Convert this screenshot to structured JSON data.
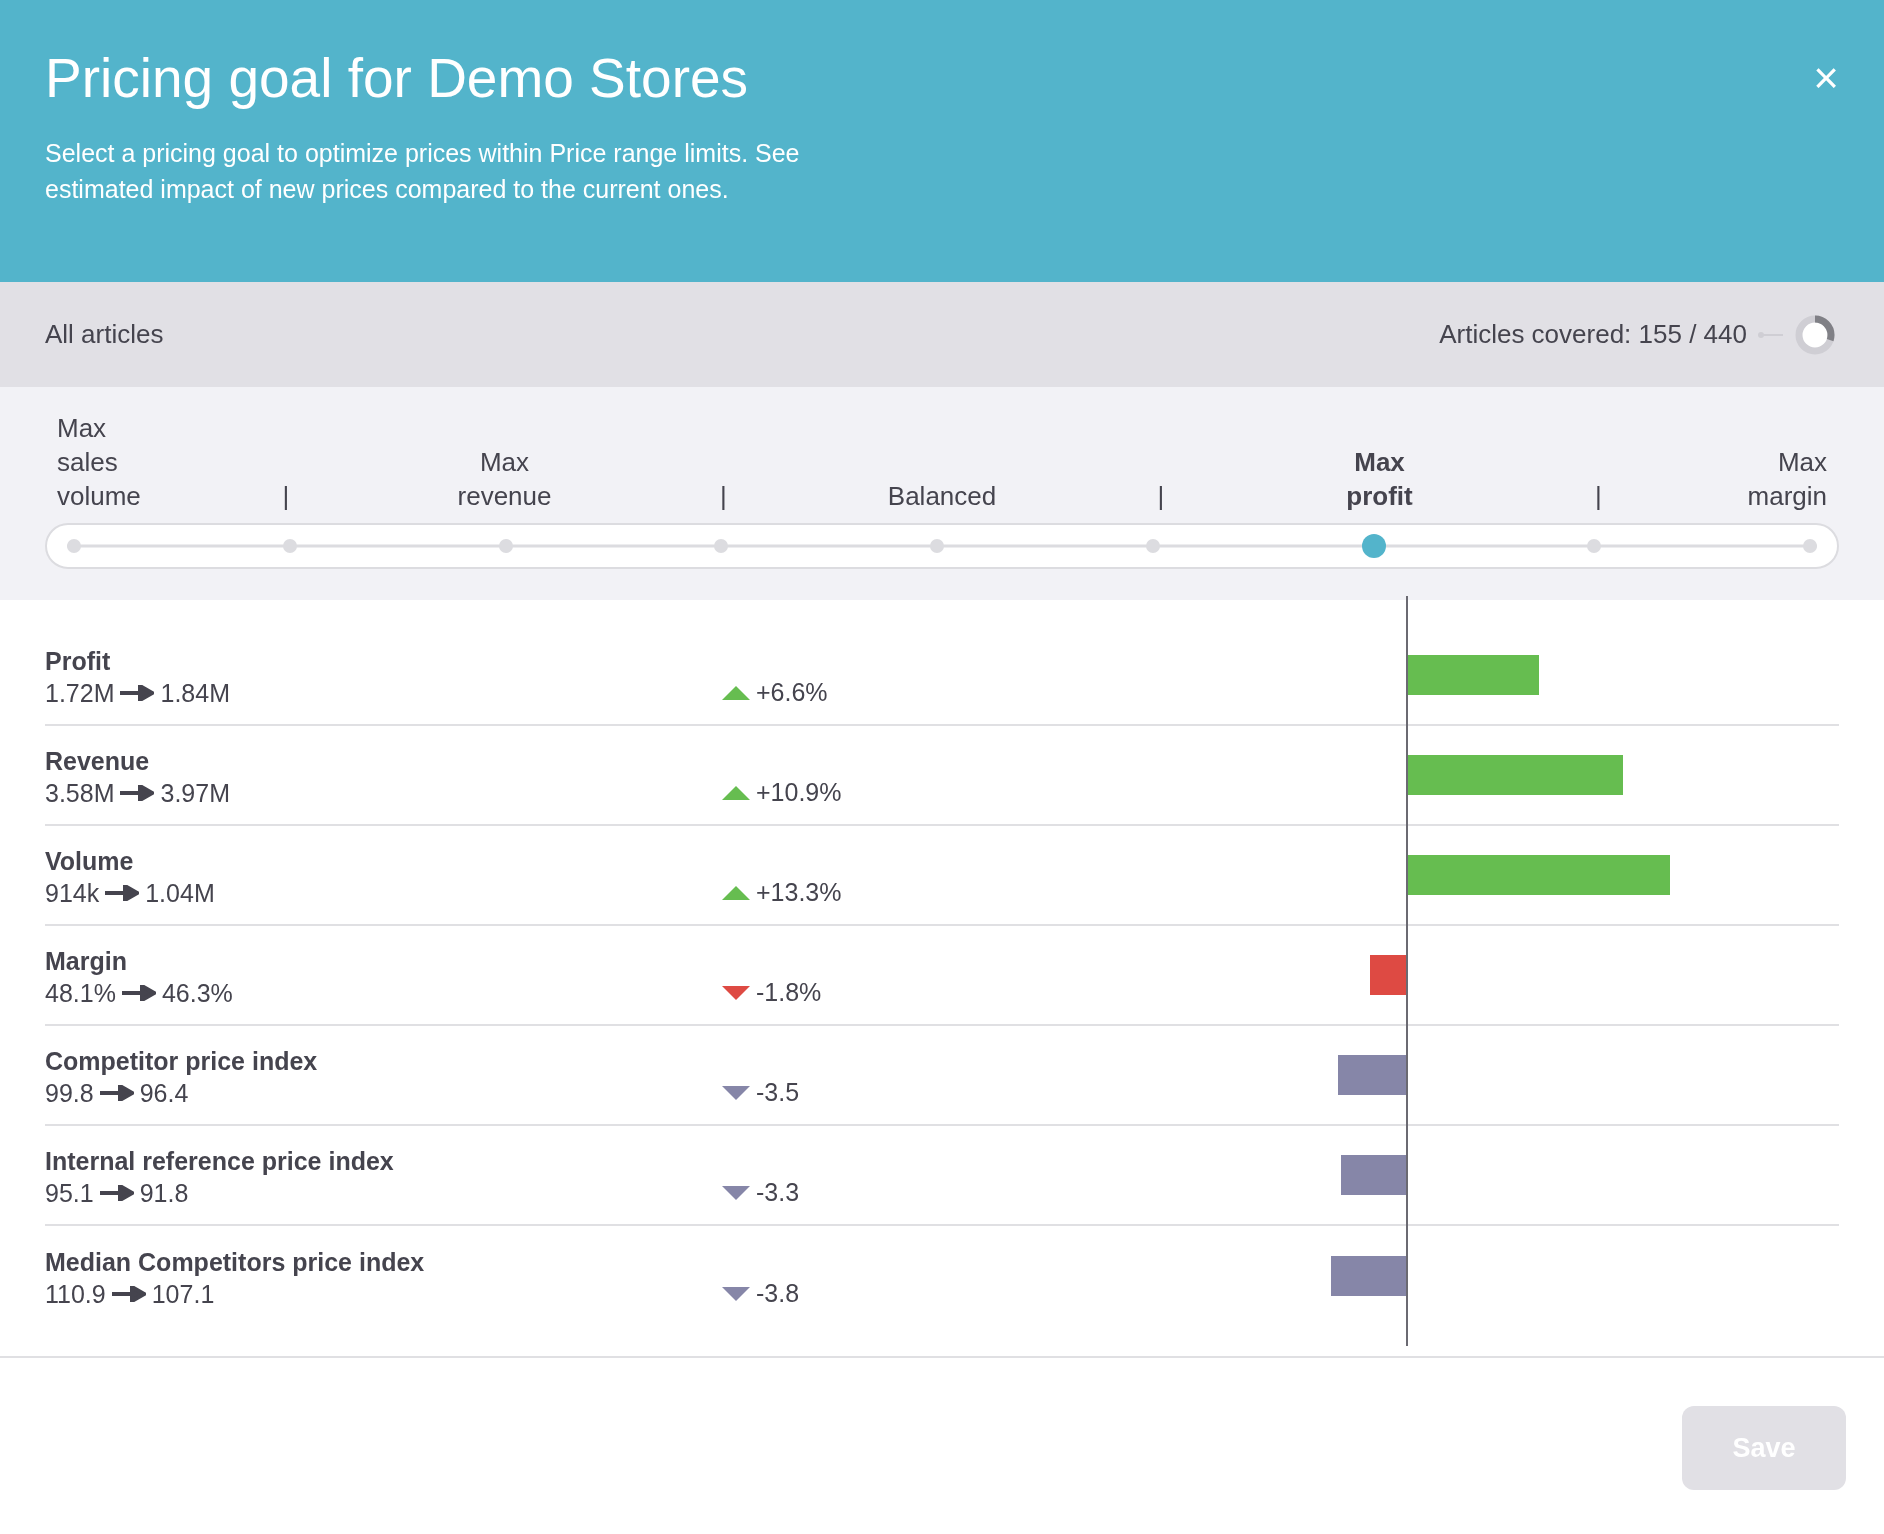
{
  "header": {
    "title": "Pricing goal for Demo Stores",
    "description": "Select a pricing goal to optimize prices within Price range limits. See estimated impact of new prices compared to the current ones.",
    "close": "×"
  },
  "scope": {
    "label": "All articles",
    "coverage": "Articles covered: 155 / 440"
  },
  "goal_slider": {
    "stops": [
      {
        "label": "Max sales volume",
        "selected": false
      },
      {
        "label": "|",
        "selected": false
      },
      {
        "label": "Max revenue",
        "selected": false
      },
      {
        "label": "|",
        "selected": false
      },
      {
        "label": "Balanced",
        "selected": false
      },
      {
        "label": "|",
        "selected": false
      },
      {
        "label": "Max profit",
        "selected": true
      },
      {
        "label": "|",
        "selected": false
      },
      {
        "label": "Max margin",
        "selected": false
      }
    ]
  },
  "metrics": [
    {
      "name": "Profit",
      "from": "1.72M",
      "to": "1.84M",
      "delta": "+6.6%",
      "rising": true,
      "color": "#66bd50"
    },
    {
      "name": "Revenue",
      "from": "3.58M",
      "to": "3.97M",
      "delta": "+10.9%",
      "rising": true,
      "color": "#66bd50"
    },
    {
      "name": "Volume",
      "from": "914k",
      "to": "1.04M",
      "delta": "+13.3%",
      "rising": true,
      "color": "#66bd50"
    },
    {
      "name": "Margin",
      "from": "48.1%",
      "to": "46.3%",
      "delta": "-1.8%",
      "rising": false,
      "color": "#de4a43"
    },
    {
      "name": "Competitor price index",
      "from": "99.8",
      "to": "96.4",
      "delta": "-3.5",
      "rising": false,
      "color": "#8686a8"
    },
    {
      "name": "Internal reference price index",
      "from": "95.1",
      "to": "91.8",
      "delta": "-3.3",
      "rising": false,
      "color": "#8686a8"
    },
    {
      "name": "Median Competitors price index",
      "from": "110.9",
      "to": "107.1",
      "delta": "-3.8",
      "rising": false,
      "color": "#8686a8"
    }
  ],
  "footer": {
    "save": "Save",
    "disabled": true
  }
}
